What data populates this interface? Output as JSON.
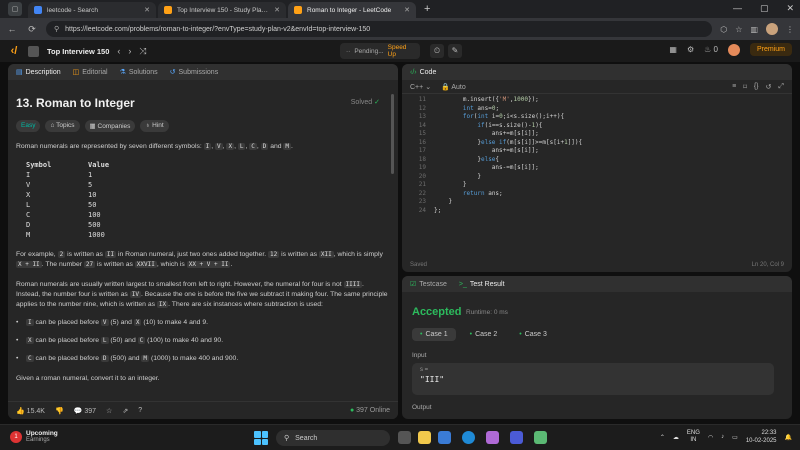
{
  "browser": {
    "tabs": [
      {
        "title": "leetcode - Search",
        "color": "#4285f4"
      },
      {
        "title": "Top Interview 150 - Study Plan - L",
        "color": "#ffa116"
      },
      {
        "title": "Roman to Integer - LeetCode",
        "color": "#ffa116"
      }
    ],
    "url": "https://leetcode.com/problems/roman-to-integer/?envType=study-plan-v2&envId=top-interview-150"
  },
  "lc": {
    "plan": "Top Interview 150",
    "pending": "Pending...",
    "speedup": "Speed Up",
    "streak": "0",
    "premium": "Premium"
  },
  "left": {
    "tabs": [
      "Description",
      "Editorial",
      "Solutions",
      "Submissions"
    ],
    "title": "13. Roman to Integer",
    "solved": "Solved",
    "tags": [
      "Easy",
      "Topics",
      "Companies",
      "Hint"
    ],
    "intro_pre": "Roman numerals are represented by seven different symbols:",
    "symbols_inline": [
      "I",
      "V",
      "X",
      "L",
      "C",
      "D",
      "M"
    ],
    "and": "and",
    "table_head": [
      "Symbol",
      "Value"
    ],
    "table": [
      [
        "I",
        "1"
      ],
      [
        "V",
        "5"
      ],
      [
        "X",
        "10"
      ],
      [
        "L",
        "50"
      ],
      [
        "C",
        "100"
      ],
      [
        "D",
        "500"
      ],
      [
        "M",
        "1000"
      ]
    ],
    "ex_p1": "For example,",
    "ex_c1": "2",
    "ex_p2": "is written as",
    "ex_c2": "II",
    "ex_p3": "in Roman numeral, just two ones added together.",
    "ex_c3": "12",
    "ex_p4": "is written as",
    "ex_c4": "XII",
    "ex_p5": ", which is simply",
    "ex_c5": "X + II",
    "ex_p6": ". The number",
    "ex_c6": "27",
    "ex_p7": "is written as",
    "ex_c7": "XXVII",
    "ex_p8": ", which is",
    "ex_c8": "XX + V + II",
    "ex_p9": ".",
    "p2_a": "Roman numerals are usually written largest to smallest from left to right. However, the numeral for four is not",
    "p2_c1": "IIII",
    "p2_b": ". Instead, the number four is written as",
    "p2_c2": "IV",
    "p2_c": ". Because the one is before the five we subtract it making four. The same principle applies to the number nine, which is written as",
    "p2_c3": "IX",
    "p2_d": ". There are six instances where subtraction is used:",
    "bullets": [
      {
        "c1": "I",
        "t1": "can be placed before",
        "c2": "V",
        "t2": "(5) and",
        "c3": "X",
        "t3": "(10) to make 4 and 9."
      },
      {
        "c1": "X",
        "t1": "can be placed before",
        "c2": "L",
        "t2": "(50) and",
        "c3": "C",
        "t3": "(100) to make 40 and 90."
      },
      {
        "c1": "C",
        "t1": "can be placed before",
        "c2": "D",
        "t2": "(500) and",
        "c3": "M",
        "t3": "(1000) to make 400 and 900."
      }
    ],
    "last": "Given a roman numeral, convert it to an integer.",
    "likes": "15.4K",
    "comments": "397",
    "online": "397 Online"
  },
  "code": {
    "title": "Code",
    "lang": "C++",
    "mode": "Auto",
    "saved": "Saved",
    "position": "Ln 20, Col 9",
    "line_numbers": [
      "11",
      "12",
      "13",
      "14",
      "15",
      "16",
      "17",
      "18",
      "19",
      "20",
      "21",
      "22",
      "23",
      "24"
    ]
  },
  "test": {
    "tab1": "Testcase",
    "tab2": "Test Result",
    "status": "Accepted",
    "runtime": "Runtime: 0 ms",
    "cases": [
      "Case 1",
      "Case 2",
      "Case 3"
    ],
    "input_label": "Input",
    "var": "s =",
    "value": "\"III\"",
    "output_label": "Output"
  },
  "taskbar": {
    "weather_title": "Upcoming",
    "weather_sub": "Earnings",
    "badge": "1",
    "search": "Search",
    "lang1": "ENG",
    "lang2": "IN",
    "time": "22:33",
    "date": "10-02-2025"
  }
}
